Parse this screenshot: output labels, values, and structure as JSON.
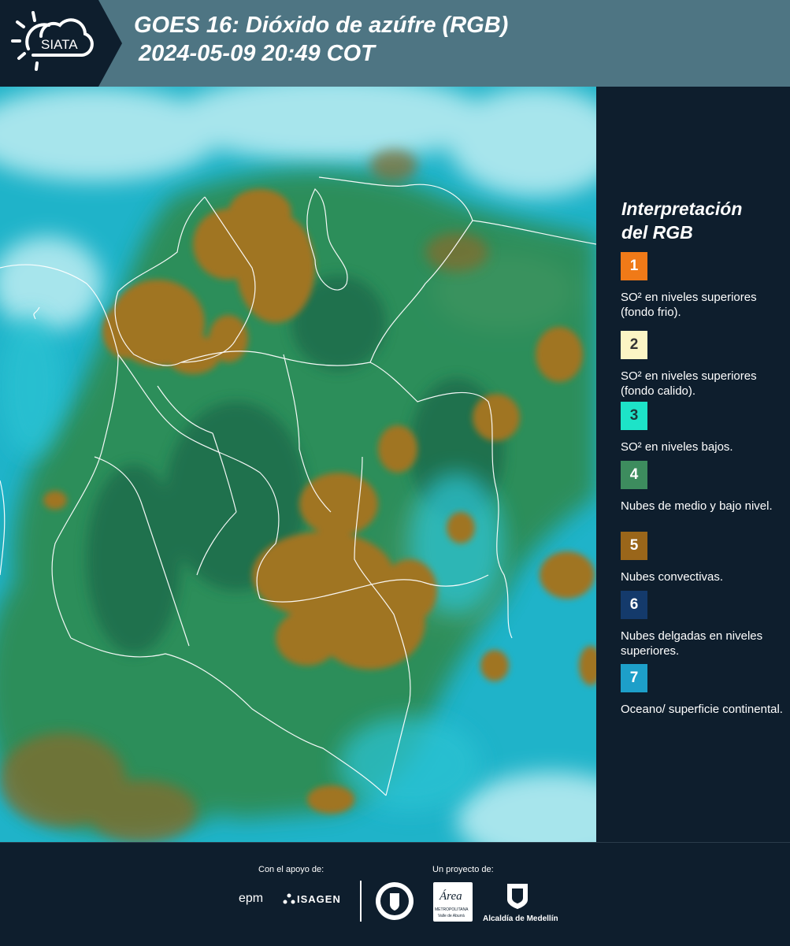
{
  "header": {
    "logo_text": "SIATA",
    "title_line1": "GOES 16: Dióxido de azúfre (RGB)",
    "title_line2": "2024-05-09 20:49 COT"
  },
  "legend": {
    "title_line1": "Interpretación",
    "title_line2": "del RGB",
    "items": [
      {
        "number": "1",
        "color": "#f07a18",
        "text_color": "#ffffff",
        "description": "SO² en niveles superiores (fondo frio)."
      },
      {
        "number": "2",
        "color": "#fbf5c4",
        "text_color": "#333333",
        "description": "SO² en niveles superiores (fondo calido)."
      },
      {
        "number": "3",
        "color": "#1de3c8",
        "text_color": "#1a3a3a",
        "description": "SO² en niveles bajos."
      },
      {
        "number": "4",
        "color": "#3d8c5e",
        "text_color": "#ffffff",
        "description": "Nubes de medio y bajo nivel."
      },
      {
        "number": "5",
        "color": "#9a661a",
        "text_color": "#ffffff",
        "description": "Nubes convectivas."
      },
      {
        "number": "6",
        "color": "#143a6b",
        "text_color": "#ffffff",
        "description": "Nubes delgadas en niveles superiores."
      },
      {
        "number": "7",
        "color": "#1d9fc9",
        "text_color": "#ffffff",
        "description": "Oceano/ superficie continental."
      }
    ]
  },
  "footer": {
    "support_label": "Con el apoyo de:",
    "project_label": "Un proyecto de:",
    "sponsor1": "epm",
    "sponsor2": "ISAGEN",
    "partner1": "Área",
    "partner1_sub": "METROPOLITANA",
    "partner1_sub2": "Valle de Aburrá",
    "partner2": "Alcaldía de Medellín"
  },
  "map": {
    "description_colors": {
      "ocean": "#1fb3c9",
      "vegetation": "#2e8a4f",
      "convective": "#a07424"
    }
  }
}
